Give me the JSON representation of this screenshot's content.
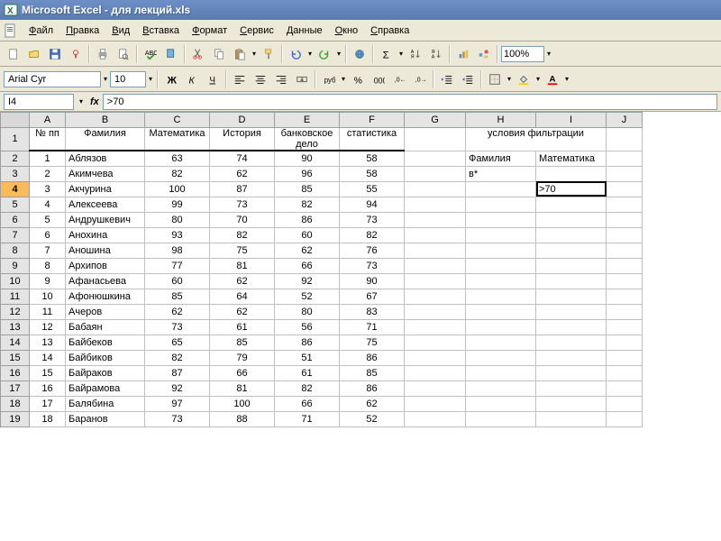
{
  "app": {
    "title": "Microsoft Excel - для лекций.xls"
  },
  "menu": {
    "items": [
      "Файл",
      "Правка",
      "Вид",
      "Вставка",
      "Формат",
      "Сервис",
      "Данные",
      "Окно",
      "Справка"
    ]
  },
  "toolbar": {
    "zoom": "100%"
  },
  "format_bar": {
    "font": "Arial Cyr",
    "size": "10"
  },
  "formula_bar": {
    "name_box": "I4",
    "formula": ">70"
  },
  "columns": [
    "A",
    "B",
    "C",
    "D",
    "E",
    "F",
    "G",
    "H",
    "I",
    "J"
  ],
  "header_row_index": 1,
  "headers": {
    "A": "№ пп",
    "B": "Фамилия",
    "C": "Математика",
    "D": "История",
    "E": "банковское дело",
    "F": "статистика"
  },
  "criteria": {
    "title": "условия фильтрации",
    "fields": {
      "H": "Фамилия",
      "I": "Математика"
    },
    "values": {
      "H": "в*",
      "I": ">70"
    }
  },
  "selected_cell": "I4",
  "rows": [
    {
      "n": 1,
      "fam": "Аблязов",
      "math": 63,
      "hist": 74,
      "bank": 90,
      "stat": 58
    },
    {
      "n": 2,
      "fam": "Акимчева",
      "math": 82,
      "hist": 62,
      "bank": 96,
      "stat": 58
    },
    {
      "n": 3,
      "fam": "Акчурина",
      "math": 100,
      "hist": 87,
      "bank": 85,
      "stat": 55
    },
    {
      "n": 4,
      "fam": "Алексеева",
      "math": 99,
      "hist": 73,
      "bank": 82,
      "stat": 94
    },
    {
      "n": 5,
      "fam": "Андрушкевич",
      "math": 80,
      "hist": 70,
      "bank": 86,
      "stat": 73
    },
    {
      "n": 6,
      "fam": "Анохина",
      "math": 93,
      "hist": 82,
      "bank": 60,
      "stat": 82
    },
    {
      "n": 7,
      "fam": "Аношина",
      "math": 98,
      "hist": 75,
      "bank": 62,
      "stat": 76
    },
    {
      "n": 8,
      "fam": "Архипов",
      "math": 77,
      "hist": 81,
      "bank": 66,
      "stat": 73
    },
    {
      "n": 9,
      "fam": "Афанасьева",
      "math": 60,
      "hist": 62,
      "bank": 92,
      "stat": 90
    },
    {
      "n": 10,
      "fam": "Афонюшкина",
      "math": 85,
      "hist": 64,
      "bank": 52,
      "stat": 67
    },
    {
      "n": 11,
      "fam": "Ачеров",
      "math": 62,
      "hist": 62,
      "bank": 80,
      "stat": 83
    },
    {
      "n": 12,
      "fam": "Бабаян",
      "math": 73,
      "hist": 61,
      "bank": 56,
      "stat": 71
    },
    {
      "n": 13,
      "fam": "Байбеков",
      "math": 65,
      "hist": 85,
      "bank": 86,
      "stat": 75
    },
    {
      "n": 14,
      "fam": "Байбиков",
      "math": 82,
      "hist": 79,
      "bank": 51,
      "stat": 86
    },
    {
      "n": 15,
      "fam": "Байраков",
      "math": 87,
      "hist": 66,
      "bank": 61,
      "stat": 85
    },
    {
      "n": 16,
      "fam": "Байрамова",
      "math": 92,
      "hist": 81,
      "bank": 82,
      "stat": 86
    },
    {
      "n": 17,
      "fam": "Балябина",
      "math": 97,
      "hist": 100,
      "bank": 66,
      "stat": 62
    },
    {
      "n": 18,
      "fam": "Баранов",
      "math": 73,
      "hist": 88,
      "bank": 71,
      "stat": 52
    }
  ]
}
